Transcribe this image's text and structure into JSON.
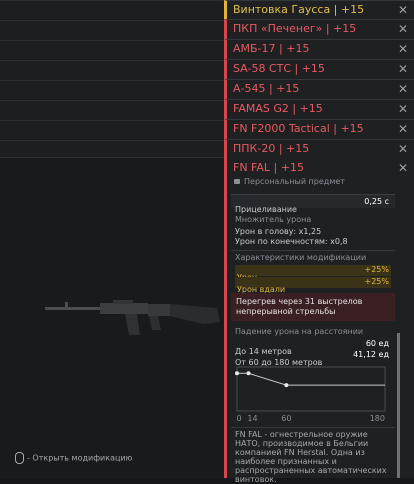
{
  "tabs": [
    {
      "label": "Винтовка Гаусса | +15",
      "gold": true
    },
    {
      "label": "ПКП «Печенег» | +15"
    },
    {
      "label": "АМБ-17 | +15"
    },
    {
      "label": "SA-58 СТС | +15"
    },
    {
      "label": "А-545 | +15"
    },
    {
      "label": "FAMAS G2 | +15"
    },
    {
      "label": "FN F2000 Tactical | +15"
    },
    {
      "label": "ППК-20 | +15"
    }
  ],
  "item": {
    "title": "FN FAL | +15",
    "subtitle": "Персональный предмет",
    "aiming_label": "Прицеливание",
    "aiming_value": "0,25 с",
    "dmg_mult_title": "Множитель урона",
    "head": "Урон в голову: x1,25",
    "limbs": "Урон по конечностям: x0,8",
    "mods_title": "Характеристики модификации",
    "mod1_label": "Урон",
    "mod1_value": "+25%",
    "mod2_label": "Урон вдали",
    "mod2_value": "+25%",
    "overheat": "Перегрев через 31 выстрелов непрерывной стрельбы",
    "falloff_title": "Падение урона на расстоянии",
    "f1_label": "До 14 метров",
    "f1_value": "60 ед",
    "f2_label": "От 60 до 180 метров",
    "f2_value": "41,12 ед",
    "ticks": [
      "0",
      "14",
      "60",
      "180"
    ],
    "description": "FN FAL - огнестрельное оружие НАТО, производимое в Бельгии компанией FN Herstal. Одна из наиболее признанных и распространенных автоматических винтовок."
  },
  "hint": "- Открыть модификацию",
  "chart_data": {
    "type": "line",
    "title": "Падение урона на расстоянии",
    "x": [
      0,
      14,
      60,
      180
    ],
    "y": [
      60,
      60,
      41.12,
      41.12
    ],
    "ylim": [
      0,
      70
    ]
  }
}
